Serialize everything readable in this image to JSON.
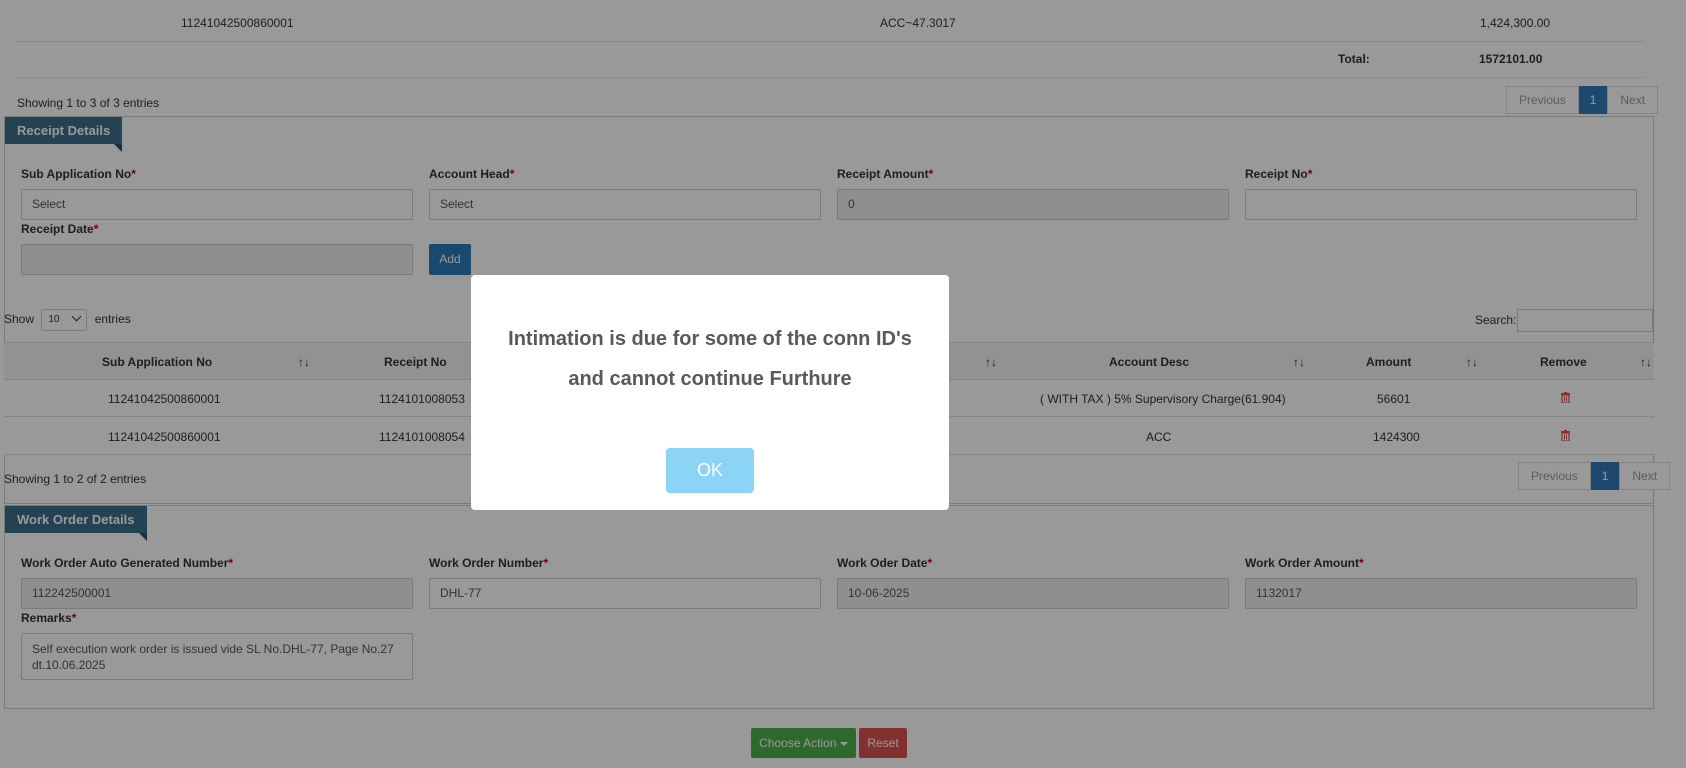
{
  "summary_table": {
    "last_row": {
      "sub_application_no": "11241042500860001",
      "account": "ACC~47.3017",
      "amount": "1,424,300.00"
    },
    "total_label": "Total:",
    "total_value": "1572101.00",
    "info": "Showing 1 to 3 of 3 entries",
    "pager": {
      "previous": "Previous",
      "page": "1",
      "next": "Next"
    }
  },
  "receipt_details": {
    "title": "Receipt Details",
    "fields": {
      "sub_application_no": {
        "label": "Sub Application No",
        "value": "Select"
      },
      "account_head": {
        "label": "Account Head",
        "value": "Select"
      },
      "receipt_amount": {
        "label": "Receipt Amount",
        "value": "0"
      },
      "receipt_no": {
        "label": "Receipt No",
        "value": ""
      },
      "receipt_date": {
        "label": "Receipt Date",
        "value": ""
      }
    },
    "required_mark": "*",
    "add_button": "Add"
  },
  "receipt_table": {
    "show_label": "Show",
    "page_length": "10",
    "entries_label": "entries",
    "search_label": "Search:",
    "columns": [
      "Sub Application No",
      "Receipt No",
      "Account Desc",
      "Amount",
      "Remove"
    ],
    "rows": [
      {
        "sub_application_no": "11241042500860001",
        "receipt_no": "1124101008053",
        "account_desc": "( WITH TAX ) 5% Supervisory Charge(61.904)",
        "amount": "56601"
      },
      {
        "sub_application_no": "11241042500860001",
        "receipt_no": "1124101008054",
        "account_desc": "ACC",
        "amount": "1424300"
      }
    ],
    "info": "Showing 1 to 2 of 2 entries",
    "pager": {
      "previous": "Previous",
      "page": "1",
      "next": "Next"
    }
  },
  "work_order_details": {
    "title": "Work Order Details",
    "fields": {
      "auto_number": {
        "label": "Work Order Auto Generated Number",
        "value": "112242500001"
      },
      "number": {
        "label": "Work Order Number",
        "value": "DHL-77"
      },
      "date": {
        "label": "Work Oder Date",
        "value": "10-06-2025"
      },
      "amount": {
        "label": "Work Order Amount",
        "value": "1132017"
      },
      "remarks": {
        "label": "Remarks",
        "value": "Self execution work order is issued vide SL No.DHL-77, Page No.27 dt.10.06.2025"
      }
    }
  },
  "actions": {
    "choose_action": "Choose Action",
    "reset": "Reset"
  },
  "modal": {
    "message": "Intimation is due for some of the conn ID's and cannot continue Furthure",
    "ok_button": "OK"
  },
  "colors": {
    "primary": "#337ab7",
    "success": "#4cae4c",
    "danger": "#d9534f",
    "ribbon": "#3e6e8e",
    "ok_button": "#8cd4f5"
  },
  "icons": {
    "remove": "trash-icon",
    "dropdown": "chevron-down-icon",
    "sort": "sort-icon",
    "caret": "caret-down-icon"
  }
}
